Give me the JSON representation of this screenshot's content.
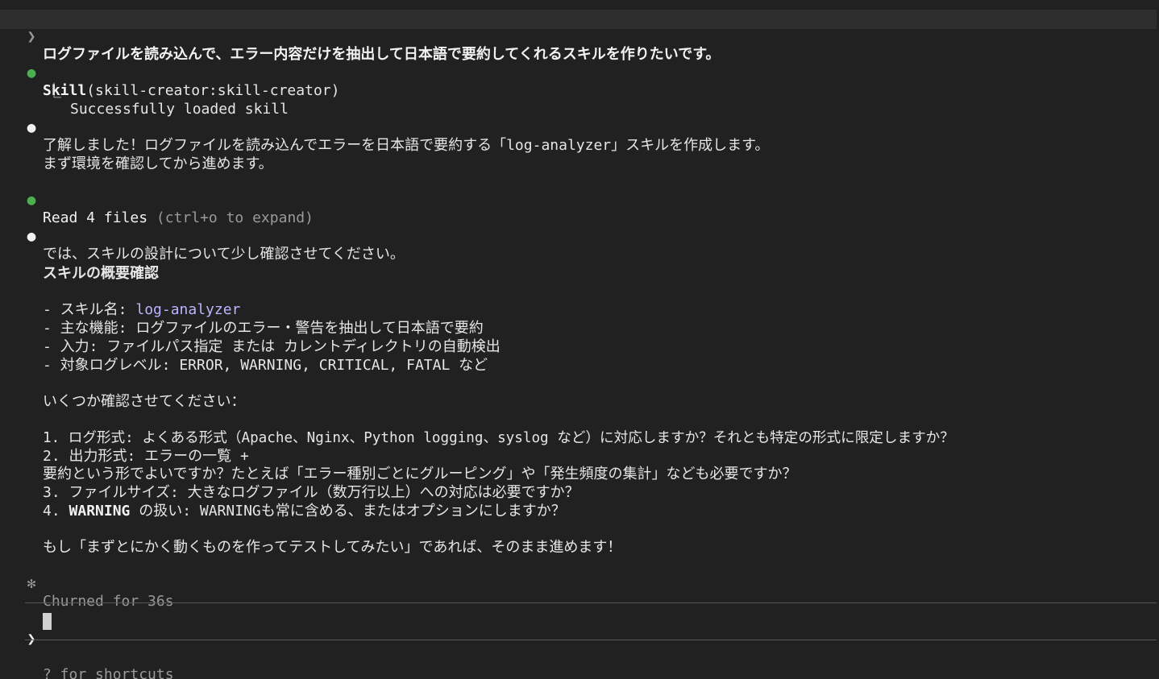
{
  "prompt": {
    "glyph": "❯",
    "text": "ログファイルを読み込んで、エラー内容だけを抽出して日本語で要約してくれるスキルを作りたいです。"
  },
  "skill_call": {
    "name": "Skill",
    "args": "(skill-creator:skill-creator)",
    "result_prefix": "⎿",
    "result": "Successfully loaded skill"
  },
  "assistant_1": "了解しました！ログファイルを読み込んでエラーを日本語で要約する「log-analyzer」スキルを作成します。",
  "assistant_2": "まず環境を確認してから進めます。",
  "read_call": {
    "label": "Read 4 files",
    "hint": "(ctrl+o to expand)"
  },
  "assistant_3": "では、スキルの設計について少し確認させてください。",
  "overview_heading": "スキルの概要確認",
  "overview": {
    "name_label": "- スキル名: ",
    "name_value": "log-analyzer",
    "feature": "- 主な機能: ログファイルのエラー・警告を抽出して日本語で要約",
    "input": "- 入力: ファイルパス指定 または カレントディレクトリの自動検出",
    "levels": "- 対象ログレベル: ERROR, WARNING, CRITICAL, FATAL など"
  },
  "questions_heading": "いくつか確認させてください：",
  "questions": {
    "q1": "1. ログ形式: よくある形式（Apache、Nginx、Python logging、syslog など）に対応しますか？それとも特定の形式に限定しますか？",
    "q2a": "2. 出力形式: エラーの一覧 +",
    "q2b": "要約という形でよいですか？たとえば「エラー種別ごとにグルーピング」や「発生頻度の集計」なども必要ですか？",
    "q3": "3. ファイルサイズ: 大きなログファイル（数万行以上）への対応は必要ですか？",
    "q4_prefix": "4. ",
    "q4_bold": "WARNING",
    "q4_rest": " の扱い: WARNINGも常に含める、またはオプションにしますか？"
  },
  "closing": "もし「まずとにかく動くものを作ってテストしてみたい」であれば、そのまま進めます！",
  "status": {
    "glyph": "✻",
    "text": "Churned for 36s"
  },
  "input": {
    "glyph": "❯",
    "value": ""
  },
  "footer_hint": "? for shortcuts",
  "colors": {
    "background": "#212121",
    "prompt_bar": "#2e2e2e",
    "bullet_green": "#4caf50",
    "link": "#b9b6ff",
    "dim": "#9a9a9a"
  }
}
